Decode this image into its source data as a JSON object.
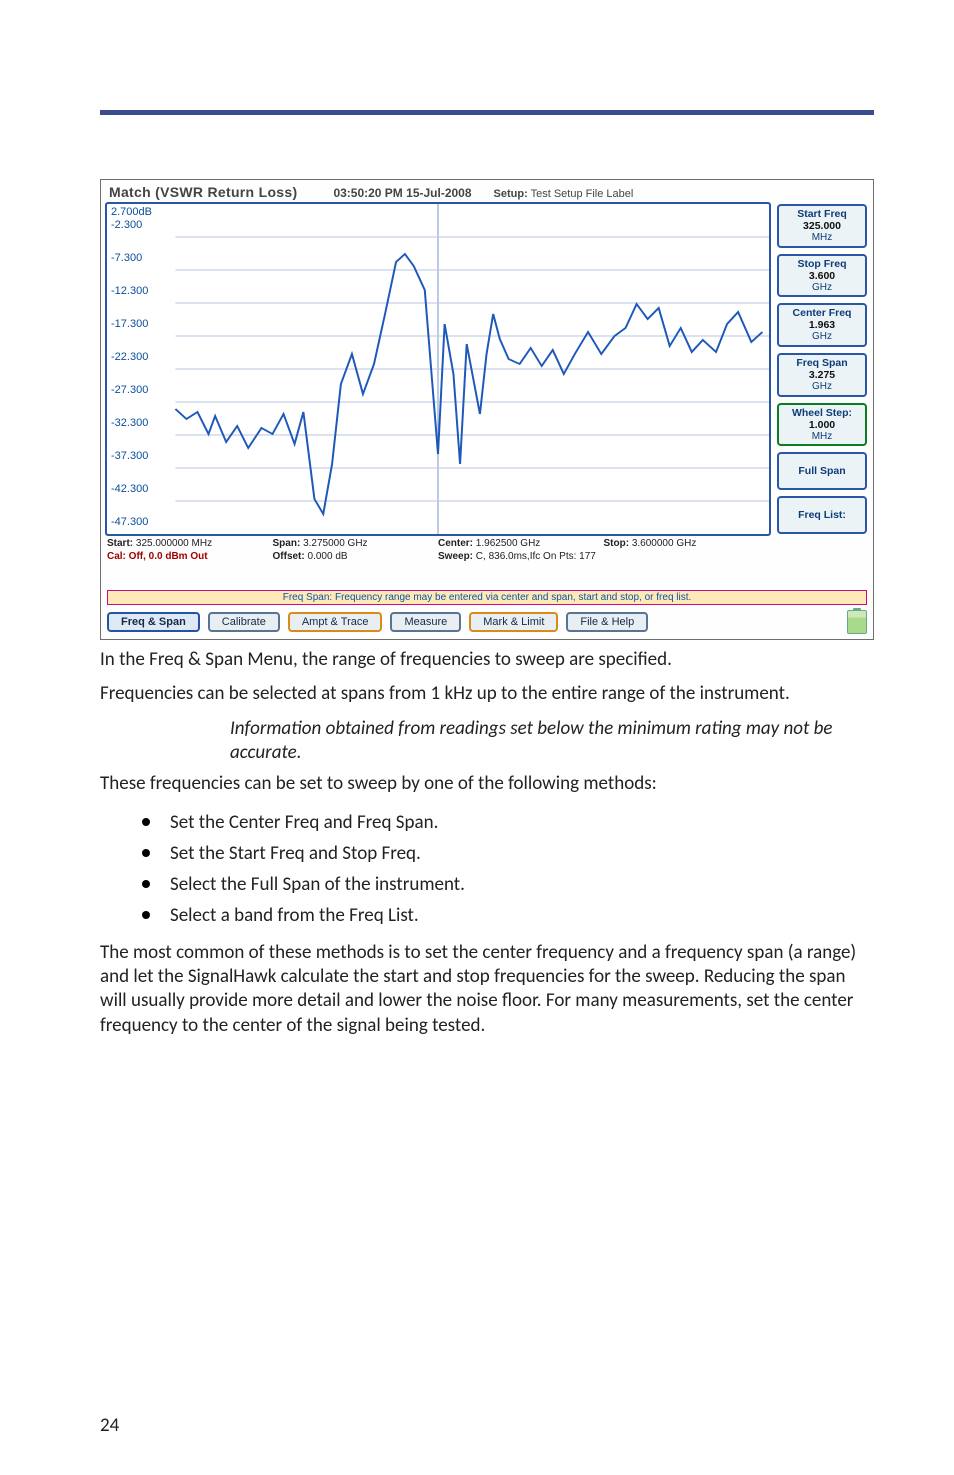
{
  "screenshot": {
    "title_mode": "Match (VSWR  Return Loss)",
    "clock": "03:50:20 PM 15-Jul-2008",
    "setup_label": "Setup:",
    "setup_value": "Test Setup File Label",
    "y_ticks": [
      "2.700dB",
      "-2.300",
      "-7.300",
      "-12.300",
      "-17.300",
      "-22.300",
      "-27.300",
      "-32.300",
      "-37.300",
      "-42.300",
      "-47.300"
    ],
    "below": {
      "start_lbl": "Start:",
      "start_val": "325.000000 MHz",
      "span_lbl": "Span:",
      "span_val": "3.275000 GHz",
      "center_lbl": "Center:",
      "center_val": "1.962500 GHz",
      "stop_lbl": "Stop:",
      "stop_val": "3.600000 GHz",
      "cal_line": "Cal: Off, 0.0 dBm Out",
      "offset_lbl": "Offset:",
      "offset_val": "0.000 dB",
      "sweep_lbl": "Sweep:",
      "sweep_val": "C, 836.0ms,Ifc On  Pts: 177"
    },
    "softkeys": [
      {
        "head": "Start Freq",
        "val": "325.000",
        "unit": "MHz"
      },
      {
        "head": "Stop Freq",
        "val": "3.600",
        "unit": "GHz"
      },
      {
        "head": "Center Freq",
        "val": "1.963",
        "unit": "GHz"
      },
      {
        "head": "Freq Span",
        "val": "3.275",
        "unit": "GHz"
      },
      {
        "head": "Wheel Step:",
        "val": "1.000",
        "unit": "MHz",
        "selected": true
      },
      {
        "single": "Full Span"
      },
      {
        "single": "Freq List:"
      },
      {
        "blank": true
      }
    ],
    "hint": "Freq  Span: Frequency range may be entered via center and span, start and stop, or freq list.",
    "tabs": [
      "Freq & Span",
      "Calibrate",
      "Ampt &  Trace",
      "Measure",
      "Mark & Limit",
      "File & Help"
    ],
    "active_tab": 0,
    "orange_tabs": [
      2,
      4
    ]
  },
  "doc": {
    "p1": "In the Freq & Span Menu, the range of frequencies to sweep are specified.",
    "p2": "Frequencies can be selected at spans from 1 kHz up to the entire range of the instrument.",
    "note": "Information obtained from readings set below the minimum rating may not be accurate.",
    "p3": "These frequencies can be set to sweep by one of the following methods:",
    "bullets": [
      "Set the Center Freq and Freq Span.",
      "Set the Start Freq and Stop Freq.",
      "Select the Full Span of the instrument.",
      "Select a band from the Freq List."
    ],
    "p4": "The most common of these methods is to set the center frequency and a frequency span (a range) and let the SignalHawk calculate the start and stop frequencies for the sweep. Reducing the span will usually provide more detail and lower the noise floor. For many measurements, set the center frequency to the center of the signal being tested.",
    "page_no": "24"
  }
}
